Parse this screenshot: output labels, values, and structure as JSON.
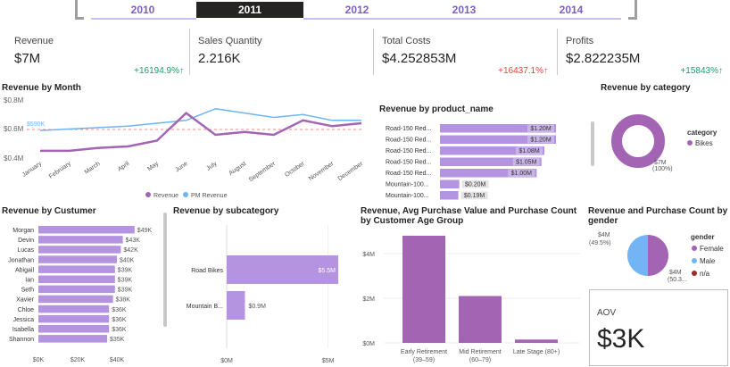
{
  "years": [
    "2010",
    "2011",
    "2012",
    "2013",
    "2014"
  ],
  "selected_year": "2011",
  "kpis": [
    {
      "title": "Revenue",
      "value": "$7M",
      "delta": "+16194.9%↑",
      "trend": "up"
    },
    {
      "title": "Sales Quantity",
      "value": "2.216K",
      "delta": "",
      "trend": "none"
    },
    {
      "title": "Total Costs",
      "value": "$4.252853M",
      "delta": "+16437.1%↑",
      "trend": "up-bad"
    },
    {
      "title": "Profits",
      "value": "$2.822235M",
      "delta": "+15843%↑",
      "trend": "up"
    }
  ],
  "colors": {
    "accent": "#a464b4",
    "pm": "#6eb4f0",
    "bar": "#b493e0",
    "green": "#1a9e6b",
    "red": "#e0453a",
    "male": "#73b4f5",
    "na": "#a0282d"
  },
  "revenue_by_month": {
    "title": "Revenue by Month",
    "months": [
      "January",
      "February",
      "March",
      "April",
      "May",
      "June",
      "July",
      "August",
      "September",
      "October",
      "November",
      "December"
    ],
    "y_ticks": [
      "$0.8M",
      "$0.6M",
      "$0.4M"
    ],
    "ref_label": "$590K",
    "legend": [
      "Revenue",
      "PM Revenue"
    ],
    "chart_data": {
      "type": "line",
      "x": [
        "January",
        "February",
        "March",
        "April",
        "May",
        "June",
        "July",
        "August",
        "September",
        "October",
        "November",
        "December"
      ],
      "ylim": [
        0.4,
        0.8
      ],
      "series": [
        {
          "name": "Revenue",
          "values": [
            0.45,
            0.45,
            0.47,
            0.48,
            0.52,
            0.71,
            0.56,
            0.58,
            0.56,
            0.66,
            0.62,
            0.64
          ]
        },
        {
          "name": "PM Revenue",
          "values": [
            0.59,
            0.6,
            0.61,
            0.62,
            0.64,
            0.66,
            0.74,
            0.71,
            0.68,
            0.7,
            0.66,
            0.66
          ]
        }
      ]
    }
  },
  "revenue_by_product": {
    "title": "Revenue by product_name",
    "chart_data": {
      "type": "bar",
      "categories": [
        "Road-150 Red...",
        "Road-150 Red...",
        "Road-150 Red...",
        "Road-150 Red...",
        "Road-150 Red...",
        "Mountain-100...",
        "Mountain-100..."
      ],
      "values": [
        1.2,
        1.2,
        1.08,
        1.05,
        1.0,
        0.2,
        0.19
      ],
      "labels": [
        "$1.20M",
        "$1.20M",
        "$1.08M",
        "$1.05M",
        "$1.00M",
        "$0.20M",
        "$0.19M"
      ]
    }
  },
  "revenue_by_category": {
    "title": "Revenue by category",
    "legend_title": "category",
    "legend_items": [
      "Bikes"
    ],
    "slice_label": "$7M",
    "slice_pct": "(100%)",
    "chart_data": {
      "type": "pie",
      "categories": [
        "Bikes"
      ],
      "values": [
        7
      ]
    }
  },
  "revenue_by_customer": {
    "title": "Revenue by Custumer",
    "x_ticks": [
      "$0K",
      "$20K",
      "$40K"
    ],
    "chart_data": {
      "type": "bar",
      "categories": [
        "Morgan",
        "Devin",
        "Lucas",
        "Jonathan",
        "Abigail",
        "Ian",
        "Seth",
        "Xavier",
        "Chloe",
        "Jessica",
        "Isabella",
        "Shannon"
      ],
      "values": [
        49,
        43,
        42,
        40,
        39,
        39,
        39,
        38,
        36,
        36,
        36,
        35
      ],
      "labels": [
        "$49K",
        "$43K",
        "$42K",
        "$40K",
        "$39K",
        "$39K",
        "$39K",
        "$38K",
        "$36K",
        "$36K",
        "$36K",
        "$35K"
      ],
      "xlim": [
        0,
        50
      ]
    }
  },
  "revenue_by_subcategory": {
    "title": "Revenue by subcategory",
    "x_ticks": [
      "$0M",
      "$5M"
    ],
    "chart_data": {
      "type": "bar",
      "categories": [
        "Road Bikes",
        "Mountain B..."
      ],
      "values": [
        5.5,
        0.9
      ],
      "labels": [
        "$5.5M",
        "$0.9M"
      ],
      "xlim": [
        0,
        5.5
      ]
    }
  },
  "revenue_by_age": {
    "title_line1": "Revenue, Avg Purchase Value and Purchase Count",
    "title_line2": "by Customer Age Group",
    "y_ticks": [
      "$4M",
      "$2M",
      "$0M"
    ],
    "chart_data": {
      "type": "bar",
      "categories": [
        [
          "Early Retirement",
          "(39–59)"
        ],
        [
          "Mid Retirement",
          "(60–79)"
        ],
        [
          "Late Stage (80+)",
          ""
        ]
      ],
      "values": [
        4.8,
        2.1,
        0.15
      ],
      "ylim": [
        0,
        5
      ]
    }
  },
  "revenue_by_gender": {
    "title_line1": "Revenue and Purchase Count by",
    "title_line2": "gender",
    "label_left": "$4M",
    "label_left_pct": "(49.5%)",
    "label_right": "$4M",
    "label_right_pct": "(50.3...",
    "legend_title": "gender",
    "legend_items": [
      "Female",
      "Male",
      "n/a"
    ],
    "chart_data": {
      "type": "pie",
      "categories": [
        "Female",
        "Male",
        "n/a"
      ],
      "values": [
        50.3,
        49.5,
        0.2
      ]
    }
  },
  "aov": {
    "title": "AOV",
    "value": "$3K"
  }
}
